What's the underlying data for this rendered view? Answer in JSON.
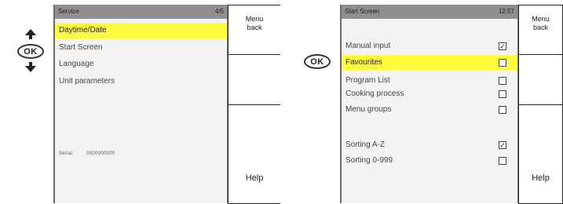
{
  "left": {
    "nav": {
      "ok_label": "OK"
    },
    "screen": {
      "title": "Service",
      "corner": "4/5",
      "items": [
        {
          "label": "Daytime/Date",
          "highlighted": true
        },
        {
          "label": "Start Screen",
          "highlighted": false
        },
        {
          "label": "Language",
          "highlighted": false
        },
        {
          "label": "Unit parameters",
          "highlighted": false
        }
      ],
      "serial_label": "Serial",
      "serial_value": "0000000000"
    },
    "softkeys": [
      {
        "label": "Menu\nback"
      },
      {
        "label": ""
      },
      {
        "label": ""
      },
      {
        "label": "Help"
      }
    ]
  },
  "right": {
    "nav": {
      "ok_label": "OK"
    },
    "screen": {
      "title": "Start Screen",
      "corner": "12:57",
      "items": [
        {
          "label": "Manual input",
          "checked": true,
          "highlighted": false
        },
        {
          "label": "Favourites",
          "checked": false,
          "highlighted": true
        },
        {
          "label": "Program List",
          "checked": false,
          "highlighted": false
        },
        {
          "label": "Cooking process",
          "checked": false,
          "highlighted": false
        },
        {
          "label": "Menu groups",
          "checked": false,
          "highlighted": false
        },
        {
          "label": "Sorting A-Z",
          "checked": true,
          "highlighted": false
        },
        {
          "label": "Sorting 0-999",
          "checked": false,
          "highlighted": false
        }
      ]
    },
    "softkeys": [
      {
        "label": "Menu\nback"
      },
      {
        "label": ""
      },
      {
        "label": ""
      },
      {
        "label": "Help"
      }
    ]
  },
  "colors": {
    "highlight": "#fffc3f",
    "header": "#8f8f8f",
    "screen_bg": "#f4f3f1"
  },
  "icons": [
    "arrow-up-icon",
    "ok-button",
    "arrow-down-icon",
    "checkbox-icon"
  ]
}
